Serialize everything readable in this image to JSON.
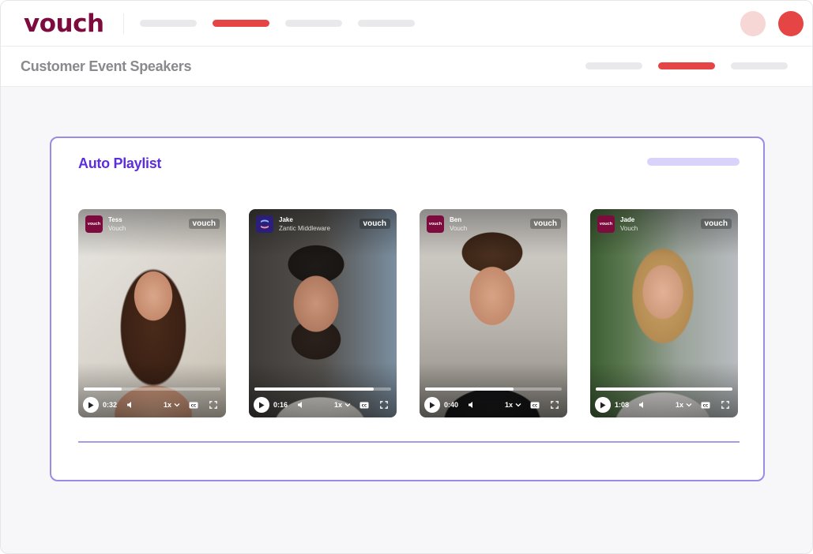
{
  "app": {
    "logo_text": "vouch",
    "brand_color": "#7d0b3d",
    "accent_color": "#e64545"
  },
  "nav": {
    "active_index": 1
  },
  "page": {
    "title": "Customer Event Speakers"
  },
  "playlist": {
    "title": "Auto Playlist",
    "title_color": "#5b2ee0",
    "videos": [
      {
        "name": "Tess",
        "company": "Vouch",
        "brand_tag": "vouch",
        "logo_label": "vouch",
        "logo_icon": "vouch-logo-icon",
        "time": "0:32",
        "speed": "1x",
        "progress": 0.28
      },
      {
        "name": "Jake",
        "company": "Zantic Middleware",
        "brand_tag": "vouch",
        "logo_label": "",
        "logo_icon": "zantic-logo-icon",
        "time": "0:16",
        "speed": "1x",
        "progress": 0.87
      },
      {
        "name": "Ben",
        "company": "Vouch",
        "brand_tag": "vouch",
        "logo_label": "vouch",
        "logo_icon": "vouch-logo-icon",
        "time": "0:40",
        "speed": "1x",
        "progress": 0.65
      },
      {
        "name": "Jade",
        "company": "Vouch",
        "brand_tag": "vouch",
        "logo_label": "vouch",
        "logo_icon": "vouch-logo-icon",
        "time": "1:08",
        "speed": "1x",
        "progress": 1.0
      }
    ]
  },
  "icons": [
    "play-icon",
    "volume-icon",
    "chevron-down-icon",
    "captions-icon",
    "fullscreen-icon"
  ]
}
